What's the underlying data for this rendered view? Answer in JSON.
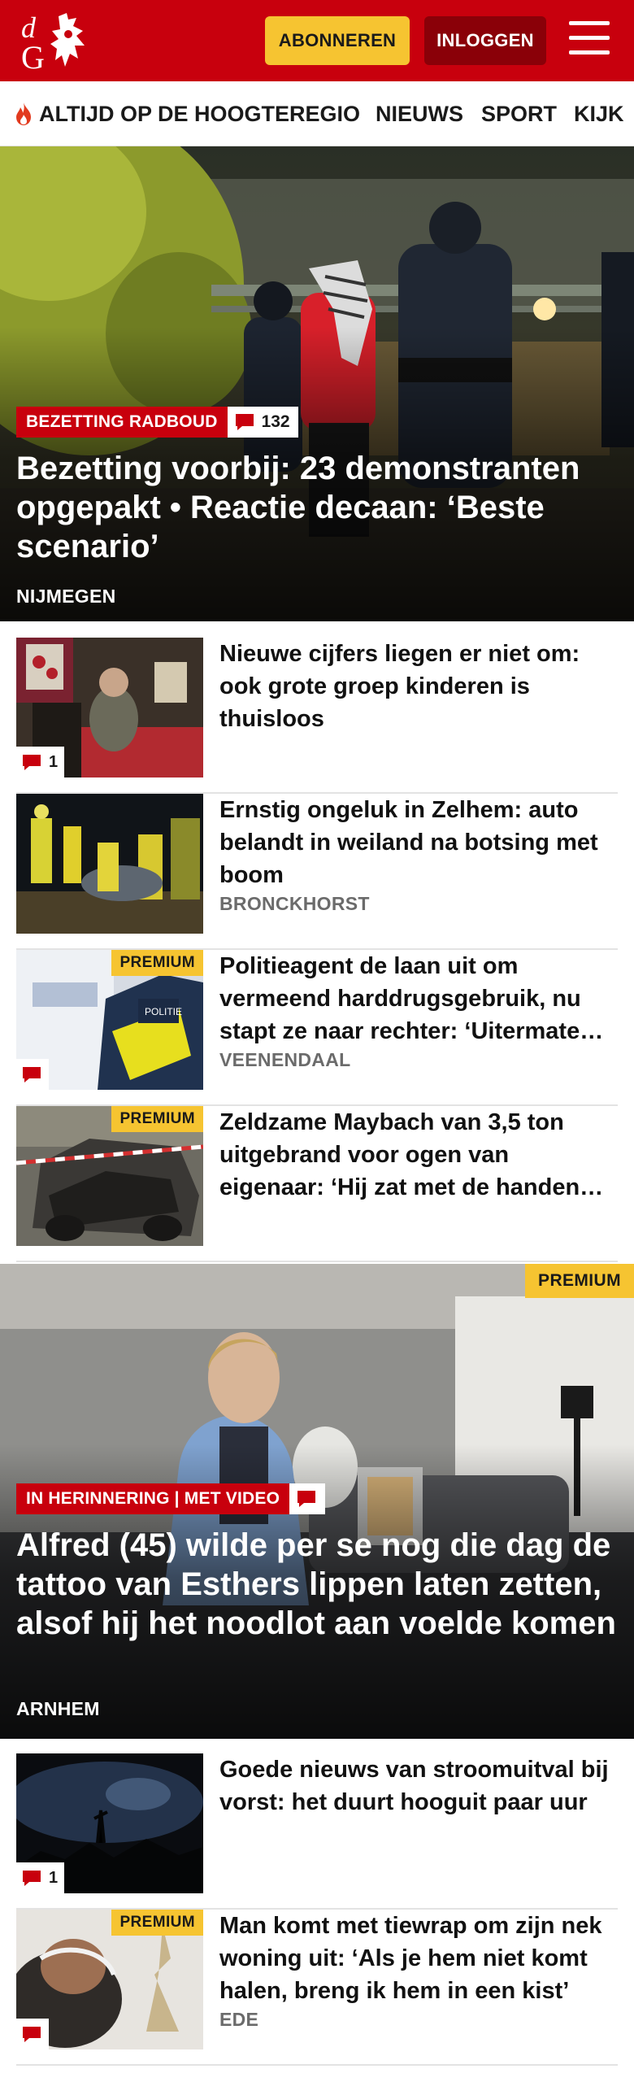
{
  "brand": {
    "logo_text": "dG",
    "red": "#c8000d",
    "yellow": "#f6c431",
    "dark_red": "#8a0008"
  },
  "header": {
    "subscribe_label": "ABONNEREN",
    "login_label": "INLOGGEN",
    "menu_icon": "hamburger-menu-icon"
  },
  "nav": {
    "items": [
      {
        "label": "ALTIJD OP DE HOOGTE",
        "icon": "flame-icon"
      },
      {
        "label": "REGIO"
      },
      {
        "label": "NIEUWS"
      },
      {
        "label": "SPORT"
      },
      {
        "label": "KIJK"
      }
    ]
  },
  "hero": {
    "tag": "BEZETTING RADBOUD",
    "comments": "132",
    "title": "Bezetting voorbij: 23 demonstranten opgepakt • Reactie decaan: ‘Beste scenario’",
    "location": "NIJMEGEN"
  },
  "articles": [
    {
      "title": "Nieuwe cijfers liegen er niet om: ook grote groep kinderen is thuisloos",
      "location": "",
      "comments": "1",
      "premium": ""
    },
    {
      "title": "Ernstig ongeluk in Zelhem: auto belandt in weiland na botsing met boom",
      "location": "BRONCKHORST",
      "comments": "",
      "premium": ""
    },
    {
      "title": "Politieagent de laan uit om vermeend harddrugsgebruik, nu stapt ze naar rechter: ‘Uitermate ongeloofwaardig’",
      "location": "VEENENDAAL",
      "comments": "",
      "premium": "PREMIUM"
    },
    {
      "title": "Zeldzame Maybach van 3,5 ton uitgebrand voor ogen van eigenaar: ‘Hij zat met de handen in het haar’",
      "location": "",
      "comments": "",
      "premium": "PREMIUM"
    }
  ],
  "feature": {
    "premium": "PREMIUM",
    "tag": "IN HERINNERING | MET VIDEO",
    "title": "Alfred (45) wilde per se nog die dag de tattoo van Esthers lippen laten zetten, alsof hij het noodlot aan voelde komen",
    "location": "ARNHEM"
  },
  "articles2": [
    {
      "title": "Goede nieuws van stroomuitval bij vorst: het duurt hooguit paar uur",
      "location": "",
      "comments": "1",
      "premium": ""
    },
    {
      "title": "Man komt met tiewrap om zijn nek woning uit: ‘Als je hem niet komt halen, breng ik hem in een kist’",
      "location": "EDE",
      "comments": "",
      "premium": "PREMIUM"
    }
  ]
}
